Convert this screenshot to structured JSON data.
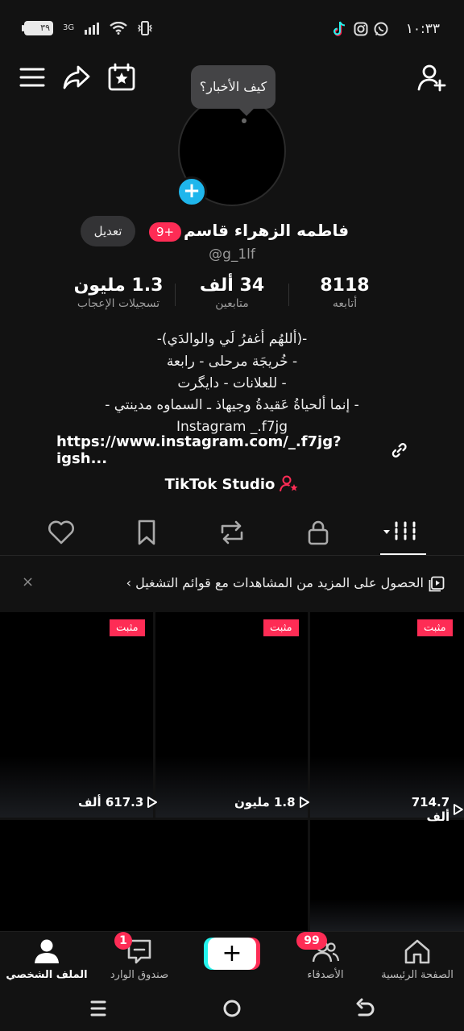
{
  "status_bar": {
    "time": "١٠:٣٣",
    "battery": "٣٩",
    "network": "3G"
  },
  "profile": {
    "tooltip": "كيف الأخبار؟",
    "name": "فاطمه الزهراء قاسم",
    "badge": "9+",
    "handle": "@g_1lf",
    "edit_label": "تعديل",
    "stats": [
      {
        "num": "8118",
        "label": "أتابعه"
      },
      {
        "num": "34 ألف",
        "label": "متابعين"
      },
      {
        "num": "1.3 مليون",
        "label": "تسجيلات الإعجاب"
      }
    ],
    "bio": [
      "-(أللهُم أغفرُ لَي والوالدَي)-",
      "خُريجَة مرحلى - رابعة -",
      "للعلانات - دايگرت -",
      "- إنما ألحياةُ عَقيدةُ وجيهاذ ـ السماوه مدينتي -",
      "Instagram _.f7jg"
    ],
    "link": "https://www.instagram.com/_.f7jg?igsh...",
    "studio": "TikTok Studio"
  },
  "banner": {
    "text": "الحصول على المزيد من المشاهدات مع قوائم التشغيل ›",
    "close": "×"
  },
  "videos": [
    {
      "pinned": "مثبت",
      "views": "714.7 ألف"
    },
    {
      "pinned": "مثبت",
      "views": "1.8 مليون"
    },
    {
      "pinned": "مثبت",
      "views": "617.3 ألف"
    }
  ],
  "bottom_nav": {
    "home": "الصفحة الرئيسية",
    "friends": "الأصدقاء",
    "friends_badge": "99",
    "create": "+",
    "inbox": "صندوق الوارد",
    "inbox_badge": "1",
    "profile": "الملف الشخصي"
  },
  "colors": {
    "accent": "#fe2c55",
    "cyan": "#25f4ee",
    "blue": "#1fb6ec"
  }
}
